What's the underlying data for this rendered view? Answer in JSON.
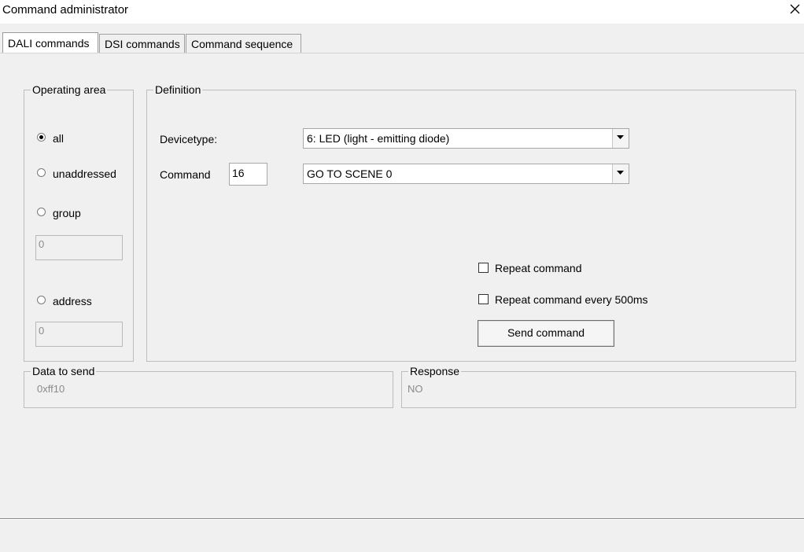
{
  "window": {
    "title": "Command administrator"
  },
  "tabs": [
    {
      "label": "DALI commands",
      "active": true
    },
    {
      "label": "DSI commands",
      "active": false
    },
    {
      "label": "Command sequence",
      "active": false
    }
  ],
  "operating_area": {
    "legend": "Operating area",
    "options": [
      {
        "label": "all",
        "selected": true
      },
      {
        "label": "unaddressed",
        "selected": false
      },
      {
        "label": "group",
        "selected": false
      },
      {
        "label": "address",
        "selected": false
      }
    ],
    "group_value": "0",
    "address_value": "0"
  },
  "definition": {
    "legend": "Definition",
    "devicetype_label": "Devicetype:",
    "devicetype_value": "6: LED (light - emitting diode)",
    "command_label": "Command",
    "command_number": "16",
    "command_value": "GO TO SCENE 0",
    "repeat_label": "Repeat command",
    "repeat_checked": false,
    "repeat_500_label": "Repeat command every 500ms",
    "repeat_500_checked": false,
    "send_label": "Send command"
  },
  "data_to_send": {
    "legend": "Data to send",
    "value": "0xff10"
  },
  "response": {
    "legend": "Response",
    "value": "NO"
  }
}
